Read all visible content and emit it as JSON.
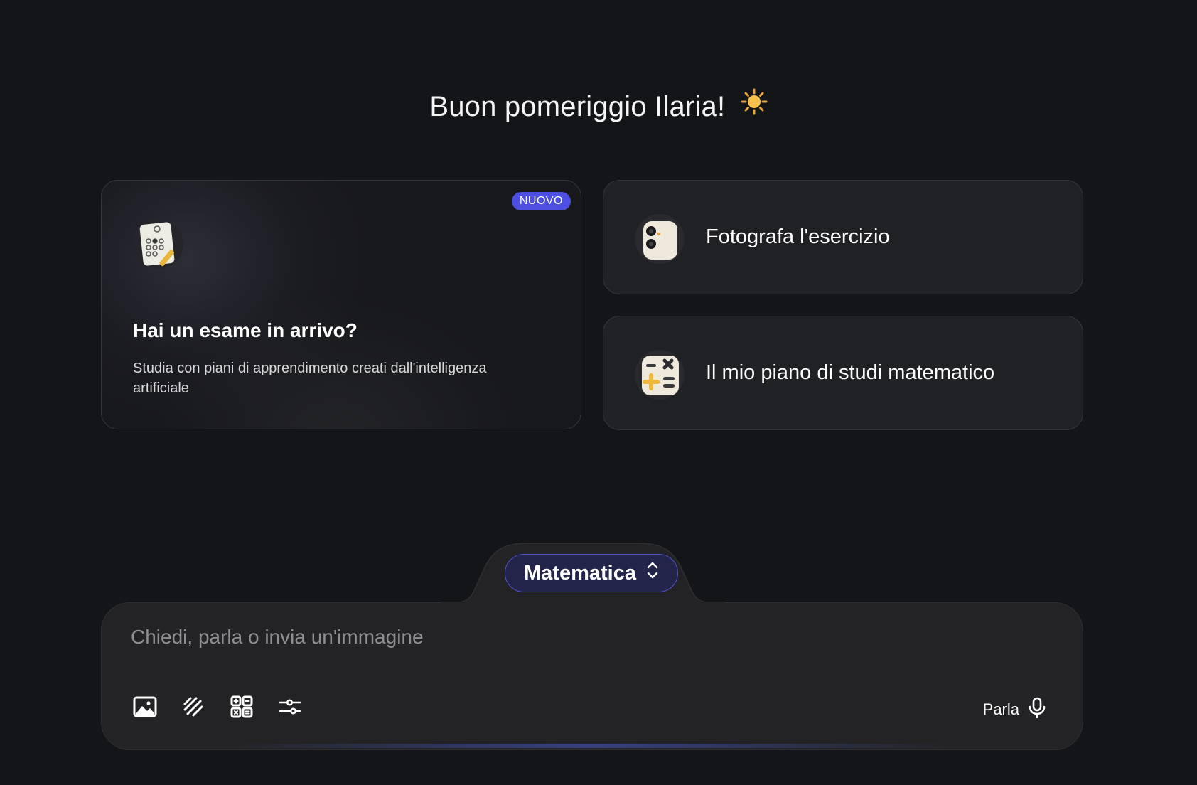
{
  "greeting": {
    "text": "Buon pomeriggio Ilaria!",
    "icon": "sun-icon"
  },
  "cards": {
    "exam": {
      "badge": "NUOVO",
      "title": "Hai un esame in arrivo?",
      "description": "Studia con piani di apprendimento creati dall'intelligenza artificiale",
      "icon": "exam-sheet-icon"
    },
    "photo": {
      "label": "Fotografa l'esercizio",
      "icon": "camera-icon"
    },
    "plan": {
      "label": "Il mio piano di studi matematico",
      "icon": "calculator-icon"
    }
  },
  "composer": {
    "subject": "Matematica",
    "placeholder": "Chiedi, parla o invia un'immagine",
    "tools": [
      "image-icon",
      "draw-icon",
      "calculator-grid-icon",
      "sliders-icon"
    ],
    "speak_label": "Parla"
  },
  "colors": {
    "background": "#141519",
    "accent": "#4c4fe0",
    "card": "#202124"
  }
}
